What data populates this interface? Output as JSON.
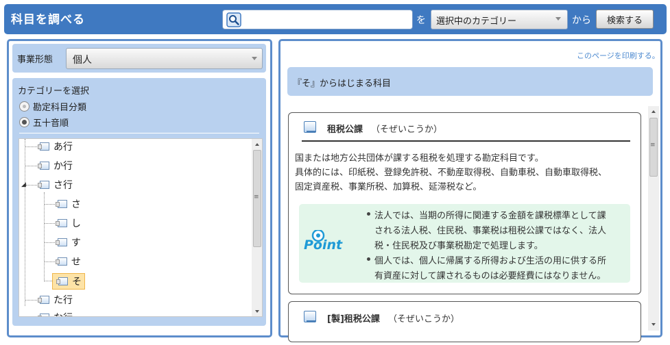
{
  "header": {
    "title": "科目を調べる",
    "search_placeholder": "",
    "wo": "を",
    "category_select": "選択中のカテゴリー",
    "kara": "から",
    "search_button": "検索する"
  },
  "left": {
    "business_type_label": "事業形態",
    "business_type_value": "個人",
    "category_heading": "カテゴリーを選択",
    "radio_options": [
      {
        "label": "勘定科目分類",
        "checked": false
      },
      {
        "label": "五十音順",
        "checked": true
      }
    ],
    "tree": [
      {
        "label": "あ行",
        "level": 0
      },
      {
        "label": "か行",
        "level": 0
      },
      {
        "label": "さ行",
        "level": 0,
        "expanded": true
      },
      {
        "label": "さ",
        "level": 1
      },
      {
        "label": "し",
        "level": 1
      },
      {
        "label": "す",
        "level": 1
      },
      {
        "label": "せ",
        "level": 1
      },
      {
        "label": "そ",
        "level": 1,
        "selected": true
      },
      {
        "label": "た行",
        "level": 0
      },
      {
        "label": "な行",
        "level": 0
      }
    ]
  },
  "right": {
    "print_link": "このページを印刷する。",
    "section_title": "『そ』からはじまる科目",
    "entries": [
      {
        "term": "租税公課",
        "reading": "（そぜいこうか）",
        "description": [
          "国または地方公共団体が課する租税を処理する勘定科目です。",
          "具体的には、印紙税、登録免許税、不動産取得税、自動車税、自動車取得税、",
          "固定資産税、事業所税、加算税、延滞税など。"
        ],
        "point_logo": "Point",
        "points": [
          [
            "法人では、当期の所得に関連する金額を課税標準として課",
            "される法人税、住民税、事業税は租税公課ではなく、法人",
            "税・住民税及び事業税勘定で処理します。"
          ],
          [
            "個人では、個人に帰属する所得および生活の用に供する所",
            "有資産に対して課されるものは必要経費にはなりません。"
          ]
        ]
      },
      {
        "term": "[製]租税公課",
        "reading": "（そぜいこうか）"
      }
    ]
  },
  "colors": {
    "header_bg": "#3f79c1",
    "panel_border": "#5d8dcb",
    "panel_fill": "#b9d1ef",
    "point_bg": "#e3f6ea",
    "selected_node": "#fde3a7",
    "link": "#4f8bd0"
  }
}
